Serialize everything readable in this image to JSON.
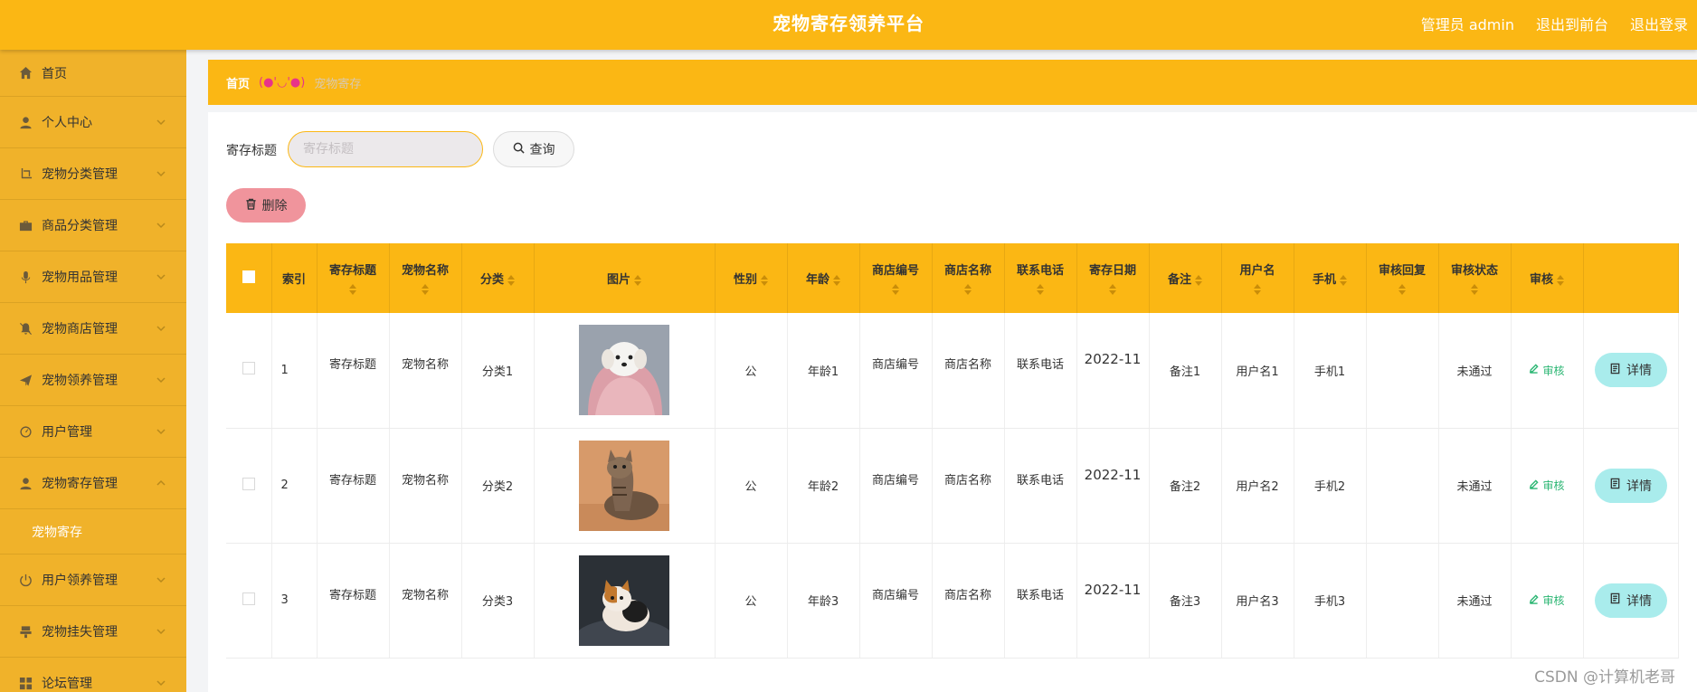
{
  "header": {
    "title": "宠物寄存领养平台",
    "admin_label": "管理员 admin",
    "back_front": "退出到前台",
    "logout": "退出登录"
  },
  "sidebar": {
    "items": [
      {
        "label": "首页",
        "icon": "home-icon"
      },
      {
        "label": "个人中心",
        "icon": "user-icon"
      },
      {
        "label": "宠物分类管理",
        "icon": "crop-icon"
      },
      {
        "label": "商品分类管理",
        "icon": "briefcase-icon"
      },
      {
        "label": "宠物用品管理",
        "icon": "microphone-icon"
      },
      {
        "label": "宠物商店管理",
        "icon": "bell-off-icon"
      },
      {
        "label": "宠物领养管理",
        "icon": "send-icon"
      },
      {
        "label": "用户管理",
        "icon": "gauge-icon"
      },
      {
        "label": "宠物寄存管理",
        "icon": "user-icon"
      },
      {
        "label": "用户领养管理",
        "icon": "power-icon"
      },
      {
        "label": "宠物挂失管理",
        "icon": "stamp-icon"
      },
      {
        "label": "论坛管理",
        "icon": "grid-icon"
      }
    ],
    "active_sub": "宠物寄存"
  },
  "breadcrumb": {
    "home": "首页",
    "separator": "(●'◡'●)",
    "current": "宠物寄存"
  },
  "search": {
    "label": "寄存标题",
    "placeholder": "寄存标题",
    "query_button": "查询"
  },
  "toolbar": {
    "delete_button": "删除"
  },
  "table": {
    "columns": [
      "索引",
      "寄存标题",
      "宠物名称",
      "分类",
      "图片",
      "性别",
      "年龄",
      "商店编号",
      "商店名称",
      "联系电话",
      "寄存日期",
      "备注",
      "用户名",
      "手机",
      "审核回复",
      "审核状态",
      "审核"
    ],
    "rows": [
      {
        "index": "1",
        "title": "寄存标题",
        "pet_name": "宠物名称",
        "category": "分类1",
        "gender": "公",
        "age": "年龄1",
        "shop_no": "商店编号",
        "shop_name": "商店名称",
        "phone": "联系电话",
        "date": "2022-11",
        "remark": "备注1",
        "username": "用户名1",
        "mobile": "手机1",
        "reply": "",
        "status": "未通过",
        "audit": "审核",
        "detail": "详情",
        "image": "white-puppy"
      },
      {
        "index": "2",
        "title": "寄存标题",
        "pet_name": "宠物名称",
        "category": "分类2",
        "gender": "公",
        "age": "年龄2",
        "shop_no": "商店编号",
        "shop_name": "商店名称",
        "phone": "联系电话",
        "date": "2022-11",
        "remark": "备注2",
        "username": "用户名2",
        "mobile": "手机2",
        "reply": "",
        "status": "未通过",
        "audit": "审核",
        "detail": "详情",
        "image": "tabby-cat"
      },
      {
        "index": "3",
        "title": "寄存标题",
        "pet_name": "宠物名称",
        "category": "分类3",
        "gender": "公",
        "age": "年龄3",
        "shop_no": "商店编号",
        "shop_name": "商店名称",
        "phone": "联系电话",
        "date": "2022-11",
        "remark": "备注3",
        "username": "用户名3",
        "mobile": "手机3",
        "reply": "",
        "status": "未通过",
        "audit": "审核",
        "detail": "详情",
        "image": "calico-cat"
      }
    ]
  },
  "watermark": "CSDN @计算机老哥"
}
